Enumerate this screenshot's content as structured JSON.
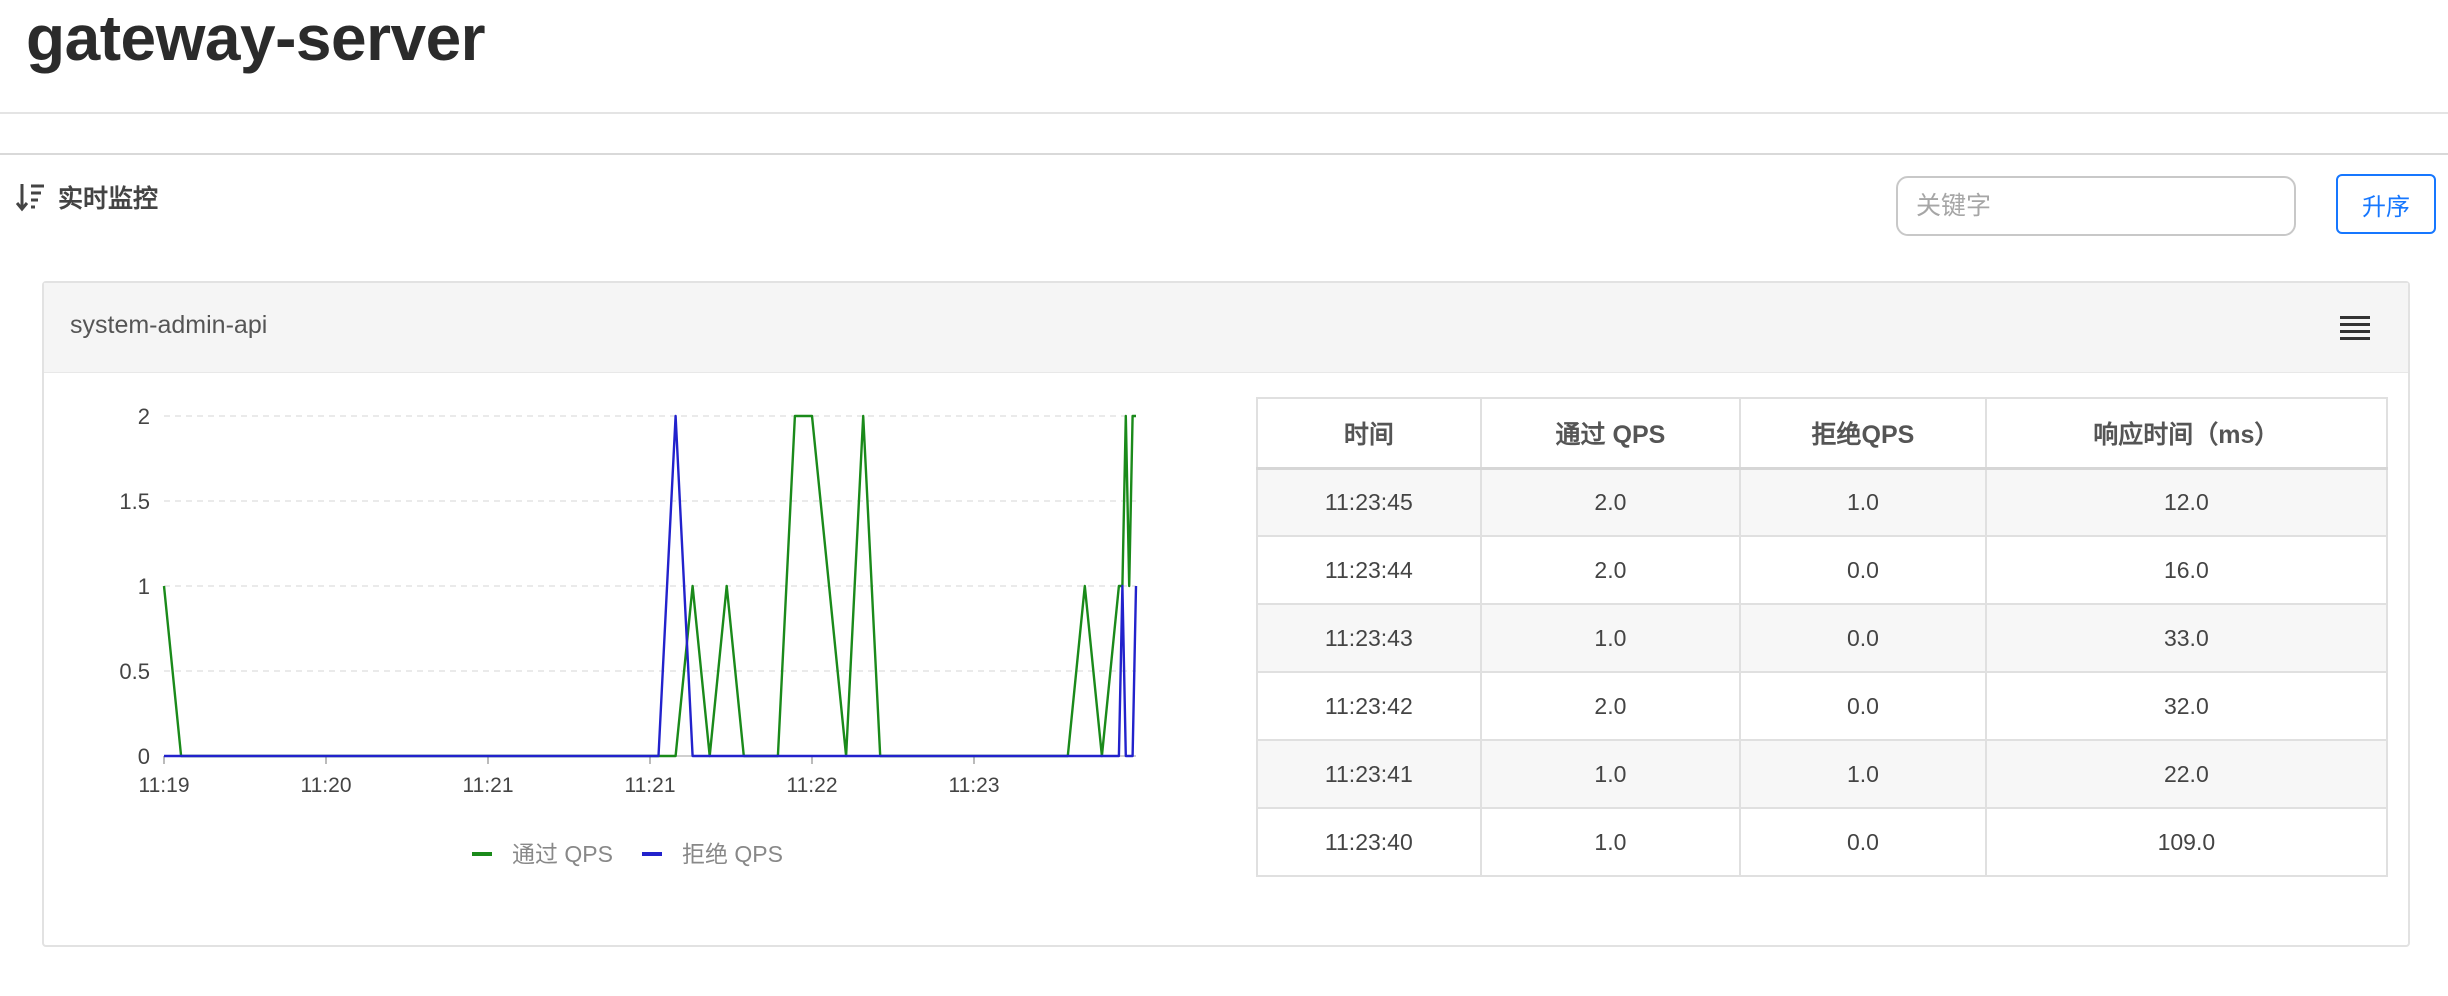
{
  "app": {
    "title": "gateway-server"
  },
  "toolbar": {
    "section_label": "实时监控",
    "search_placeholder": "关键字",
    "search_value": "",
    "sort_label": "升序",
    "accent_color": "#1677ff"
  },
  "panel": {
    "title": "system-admin-api"
  },
  "chart_data": {
    "type": "line",
    "x": [
      "11:19:00",
      "11:19:05",
      "11:19:10",
      "11:19:15",
      "11:19:20",
      "11:19:25",
      "11:19:30",
      "11:19:35",
      "11:19:40",
      "11:19:45",
      "11:19:50",
      "11:19:55",
      "11:20:00",
      "11:20:05",
      "11:20:10",
      "11:20:15",
      "11:20:20",
      "11:20:25",
      "11:20:30",
      "11:20:35",
      "11:20:40",
      "11:20:45",
      "11:20:50",
      "11:20:55",
      "11:21:00",
      "11:21:05",
      "11:21:10",
      "11:21:15",
      "11:21:20",
      "11:21:25",
      "11:21:30",
      "11:21:35",
      "11:21:40",
      "11:21:45",
      "11:21:50",
      "11:21:55",
      "11:22:00",
      "11:22:05",
      "11:22:10",
      "11:22:15",
      "11:22:20",
      "11:22:25",
      "11:22:30",
      "11:22:35",
      "11:22:40",
      "11:22:45",
      "11:22:50",
      "11:22:55",
      "11:23:00",
      "11:23:05",
      "11:23:10",
      "11:23:15",
      "11:23:20",
      "11:23:25",
      "11:23:30",
      "11:23:35",
      "11:23:40",
      "11:23:41",
      "11:23:42",
      "11:23:43",
      "11:23:44",
      "11:23:45"
    ],
    "series": [
      {
        "name": "通过 QPS",
        "color": "#1a8a1a",
        "values": [
          1,
          0,
          0,
          0,
          0,
          0,
          0,
          0,
          0,
          0,
          0,
          0,
          0,
          0,
          0,
          0,
          0,
          0,
          0,
          0,
          0,
          0,
          0,
          0,
          0,
          0,
          0,
          0,
          0,
          0,
          0,
          1,
          0,
          1,
          0,
          0,
          0,
          2,
          2,
          1,
          0,
          2,
          0,
          0,
          0,
          0,
          0,
          0,
          0,
          0,
          0,
          0,
          0,
          0,
          1,
          0,
          1,
          1,
          2,
          1,
          2,
          2
        ]
      },
      {
        "name": "拒绝 QPS",
        "color": "#2222cc",
        "values": [
          0,
          0,
          0,
          0,
          0,
          0,
          0,
          0,
          0,
          0,
          0,
          0,
          0,
          0,
          0,
          0,
          0,
          0,
          0,
          0,
          0,
          0,
          0,
          0,
          0,
          0,
          0,
          0,
          0,
          0,
          2,
          0,
          0,
          0,
          0,
          0,
          0,
          0,
          0,
          0,
          0,
          0,
          0,
          0,
          0,
          0,
          0,
          0,
          0,
          0,
          0,
          0,
          0,
          0,
          0,
          0,
          0,
          1,
          0,
          0,
          0,
          1
        ]
      }
    ],
    "tick_labels": [
      "11:19",
      "11:20",
      "11:21",
      "11:21",
      "11:22",
      "11:23"
    ],
    "ylim": [
      0,
      2
    ],
    "yticks": [
      "0",
      "0.5",
      "1",
      "1.5",
      "2"
    ],
    "grid": true,
    "legend": "bottom"
  },
  "table": {
    "columns": [
      "时间",
      "通过 QPS",
      "拒绝QPS",
      "响应时间（ms）"
    ],
    "rows": [
      [
        "11:23:45",
        "2.0",
        "1.0",
        "12.0"
      ],
      [
        "11:23:44",
        "2.0",
        "0.0",
        "16.0"
      ],
      [
        "11:23:43",
        "1.0",
        "0.0",
        "33.0"
      ],
      [
        "11:23:42",
        "2.0",
        "0.0",
        "32.0"
      ],
      [
        "11:23:41",
        "1.0",
        "1.0",
        "22.0"
      ],
      [
        "11:23:40",
        "1.0",
        "0.0",
        "109.0"
      ]
    ]
  }
}
